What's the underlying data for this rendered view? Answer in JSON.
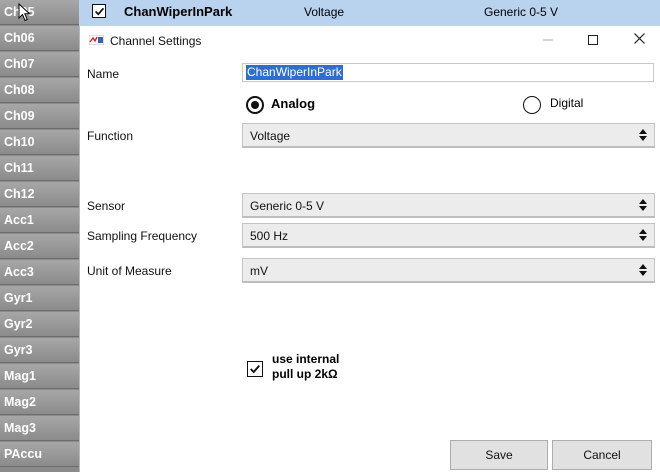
{
  "channel_list": {
    "items": [
      {
        "label": "Ch05"
      },
      {
        "label": "Ch06"
      },
      {
        "label": "Ch07"
      },
      {
        "label": "Ch08"
      },
      {
        "label": "Ch09"
      },
      {
        "label": "Ch10"
      },
      {
        "label": "Ch11"
      },
      {
        "label": "Ch12"
      },
      {
        "label": "Acc1"
      },
      {
        "label": "Acc2"
      },
      {
        "label": "Acc3"
      },
      {
        "label": "Gyr1"
      },
      {
        "label": "Gyr2"
      },
      {
        "label": "Gyr3"
      },
      {
        "label": "Mag1"
      },
      {
        "label": "Mag2"
      },
      {
        "label": "Mag3"
      },
      {
        "label": "PAccu"
      }
    ]
  },
  "top_row": {
    "checked": true,
    "name": "ChanWiperInPark",
    "function": "Voltage",
    "sensor": "Generic 0-5 V"
  },
  "dialog": {
    "title": "Channel Settings",
    "name_label": "Name",
    "name_value": "ChanWiperInPark",
    "analog_label": "Analog",
    "digital_label": "Digital",
    "analog_selected": true,
    "function_label": "Function",
    "function_value": "Voltage",
    "sensor_label": "Sensor",
    "sensor_value": "Generic 0-5 V",
    "sampling_label": "Sampling Frequency",
    "sampling_value": "500 Hz",
    "unit_label": "Unit of Measure",
    "unit_value": "mV",
    "pullup_line1": "use internal",
    "pullup_line2": "pull up 2kΩ",
    "pullup_checked": true,
    "save_label": "Save",
    "cancel_label": "Cancel"
  },
  "icons": {
    "app": "app-logo-icon",
    "minimize": "minimize-icon",
    "maximize": "maximize-icon",
    "close": "close-icon",
    "select_arrows": "updown-arrows-icon",
    "cursor": "mouse-cursor-icon"
  },
  "colors": {
    "selected_row": "#b9d2ee",
    "list_item": "#9a9a9a",
    "selection": "#2f6ed1"
  }
}
